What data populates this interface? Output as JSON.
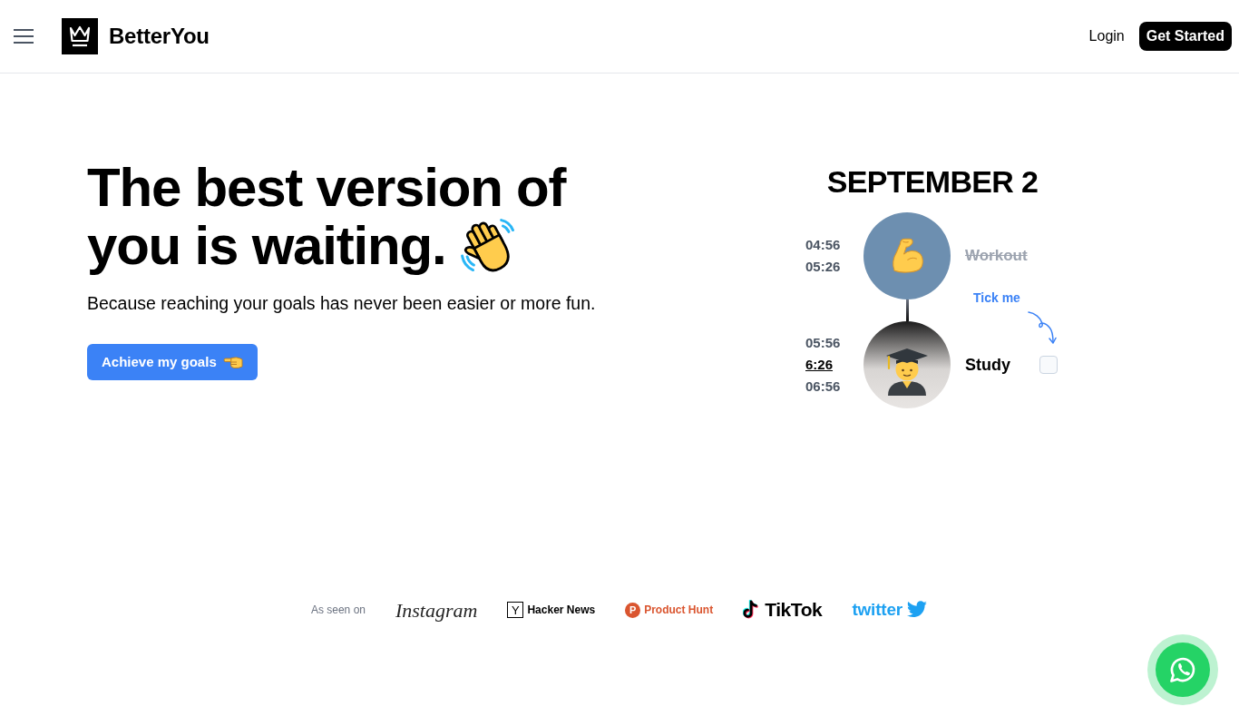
{
  "header": {
    "brand": "BetterYou",
    "links": [
      {
        "label": "Login",
        "kind": "link"
      },
      {
        "label": "Get Started",
        "kind": "button"
      }
    ]
  },
  "hero": {
    "headline_lines": [
      "The best version of",
      "you is waiting."
    ],
    "subtitle": "Because reaching your goals has never been easier or more fun.",
    "cta": {
      "label": "Achieve my goals"
    }
  },
  "schedule": {
    "date": "SEPTEMBER 2",
    "tasks": [
      {
        "title": "Workout",
        "completed": true,
        "times": [
          {
            "text": "04:56",
            "current": false
          },
          {
            "text": "05:26",
            "current": false
          }
        ]
      },
      {
        "title": "Study",
        "completed": false,
        "hint": "Tick me",
        "checkbox": {
          "checked": false
        },
        "times": [
          {
            "text": "05:56",
            "current": false
          },
          {
            "text": "6:26",
            "current": true
          },
          {
            "text": "06:56",
            "current": false
          }
        ]
      }
    ]
  },
  "press": {
    "label": "As seen on",
    "logos": [
      {
        "name": "Instagram",
        "kind": "script"
      },
      {
        "name": "Hacker News",
        "kind": "boxed",
        "mark": "Y"
      },
      {
        "name": "Product Hunt",
        "kind": "circled",
        "mark": "P"
      },
      {
        "name": "TikTok",
        "kind": "note"
      },
      {
        "name": "twitter",
        "kind": "bird"
      }
    ]
  }
}
